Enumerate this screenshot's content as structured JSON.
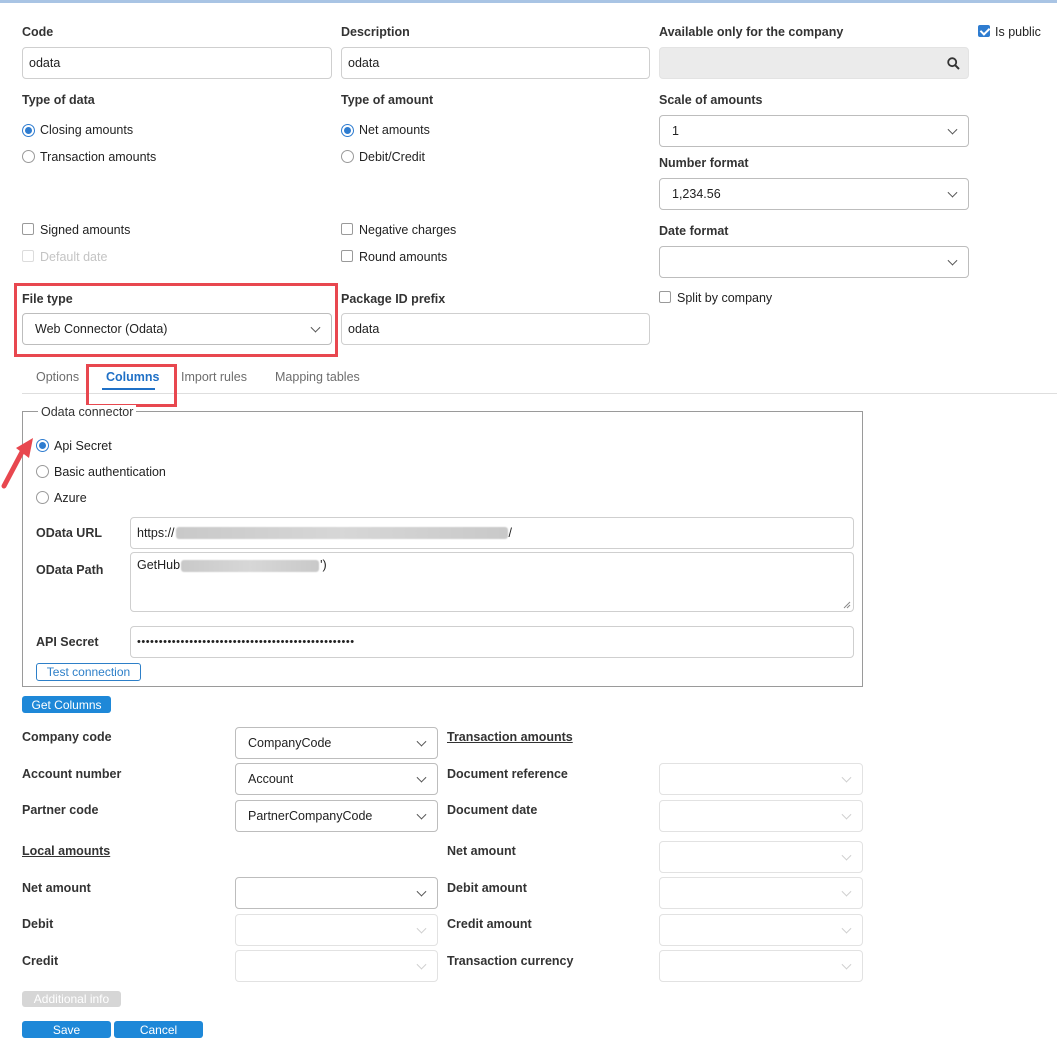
{
  "header": {
    "code_label": "Code",
    "code_value": "odata",
    "description_label": "Description",
    "description_value": "odata",
    "company_label": "Available only for the company",
    "company_value": "",
    "is_public_label": "Is public"
  },
  "type_of_data": {
    "label": "Type of data",
    "options": [
      "Closing amounts",
      "Transaction amounts"
    ],
    "selected": "Closing amounts"
  },
  "type_of_amount": {
    "label": "Type of amount",
    "options": [
      "Net amounts",
      "Debit/Credit"
    ],
    "selected": "Net amounts"
  },
  "scale": {
    "label": "Scale of amounts",
    "value": "1"
  },
  "number_format": {
    "label": "Number format",
    "value": "1,234.56"
  },
  "date_format": {
    "label": "Date format",
    "value": ""
  },
  "checkboxes": {
    "signed_amounts": "Signed amounts",
    "default_date": "Default date",
    "negative_charges": "Negative charges",
    "round_amounts": "Round amounts",
    "split_by_company": "Split by company"
  },
  "file_type": {
    "label": "File type",
    "value": "Web Connector (Odata)"
  },
  "package_prefix": {
    "label": "Package ID prefix",
    "value": "odata"
  },
  "tabs": [
    "Options",
    "Columns",
    "Import rules",
    "Mapping tables"
  ],
  "active_tab": "Columns",
  "odata": {
    "legend": "Odata connector",
    "auth_options": [
      "Api Secret",
      "Basic authentication",
      "Azure"
    ],
    "selected_auth": "Api Secret",
    "url_label": "OData URL",
    "url_prefix": "https://",
    "url_suffix": "/",
    "path_label": "OData Path",
    "path_prefix": "GetHub",
    "path_suffix": "')",
    "secret_label": "API Secret",
    "secret_value": "••••••••••••••••••••••••••••••••••••••••••••••••••",
    "test_button": "Test connection"
  },
  "get_columns_button": "Get Columns",
  "columns": {
    "company_code": {
      "label": "Company code",
      "value": "CompanyCode"
    },
    "account_number": {
      "label": "Account number",
      "value": "Account"
    },
    "partner_code": {
      "label": "Partner code",
      "value": "PartnerCompanyCode"
    },
    "local_amounts_header": "Local amounts",
    "net_amount": {
      "label": "Net amount",
      "value": ""
    },
    "debit": {
      "label": "Debit",
      "value": ""
    },
    "credit": {
      "label": "Credit",
      "value": ""
    },
    "transaction_amounts_header": "Transaction amounts",
    "document_reference": {
      "label": "Document reference",
      "value": ""
    },
    "document_date": {
      "label": "Document date",
      "value": ""
    },
    "t_net_amount": {
      "label": "Net amount",
      "value": ""
    },
    "debit_amount": {
      "label": "Debit amount",
      "value": ""
    },
    "credit_amount": {
      "label": "Credit amount",
      "value": ""
    },
    "transaction_currency": {
      "label": "Transaction currency",
      "value": ""
    }
  },
  "footer": {
    "additional_info": "Additional info",
    "save": "Save",
    "cancel": "Cancel"
  },
  "colors": {
    "accent": "#1e88d8",
    "highlight": "#e8474f"
  }
}
